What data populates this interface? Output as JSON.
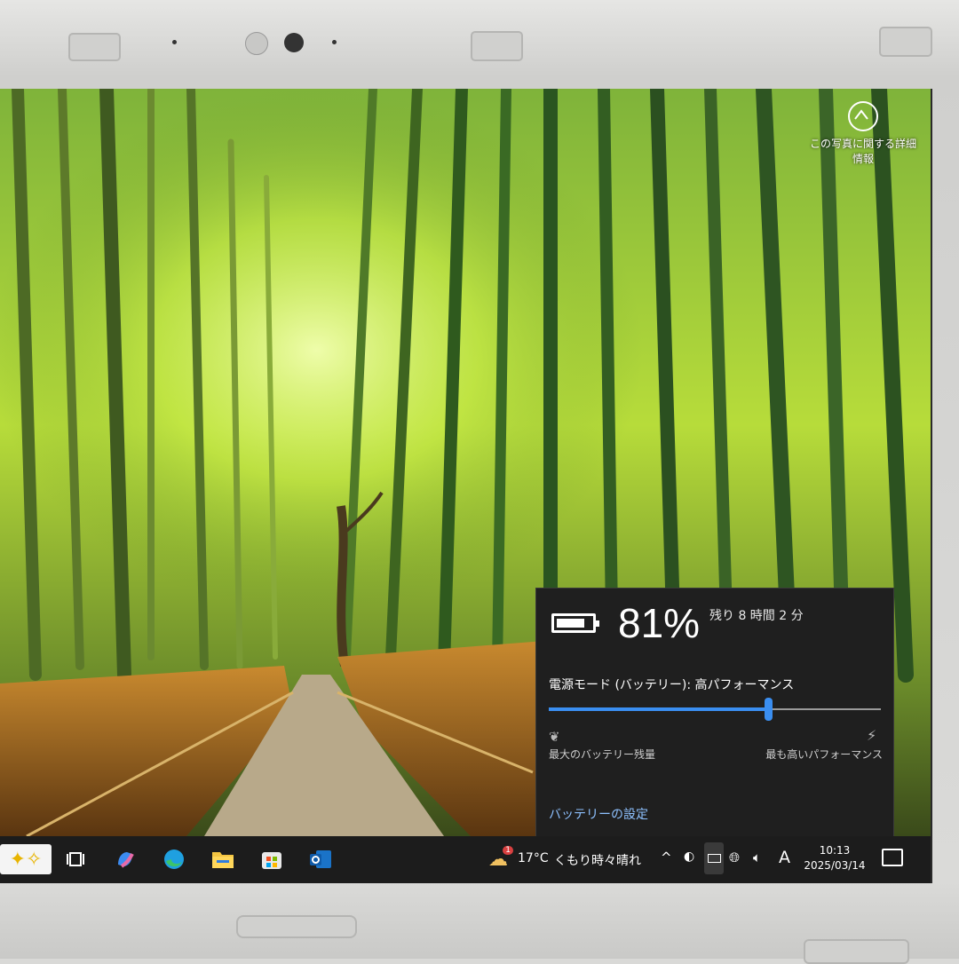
{
  "wallpaper": {
    "photo_info_label": "この写真に関する詳細情報"
  },
  "battery_flyout": {
    "percent": "81%",
    "level": 81,
    "remaining": "残り 8 時間 2 分",
    "power_mode_label": "電源モード (バッテリー): 高パフォーマンス",
    "slider_value_fraction": 0.66,
    "left_label": "最大のバッテリー残量",
    "right_label": "最も高いパフォーマンス",
    "settings_link": "バッテリーの設定",
    "accent_color": "#3a8ef0"
  },
  "taskbar": {
    "apps": [
      {
        "name": "copilot-icon"
      },
      {
        "name": "task-view-icon"
      },
      {
        "name": "copilot-app-icon"
      },
      {
        "name": "edge-icon"
      },
      {
        "name": "file-explorer-icon"
      },
      {
        "name": "microsoft-store-icon"
      },
      {
        "name": "outlook-icon"
      }
    ],
    "weather": {
      "temperature": "17°C",
      "description": "くもり時々晴れ",
      "badge": "1"
    },
    "tray": {
      "chevron": "^",
      "ime": "A"
    },
    "clock": {
      "time": "10:13",
      "date": "2025/03/14"
    }
  }
}
